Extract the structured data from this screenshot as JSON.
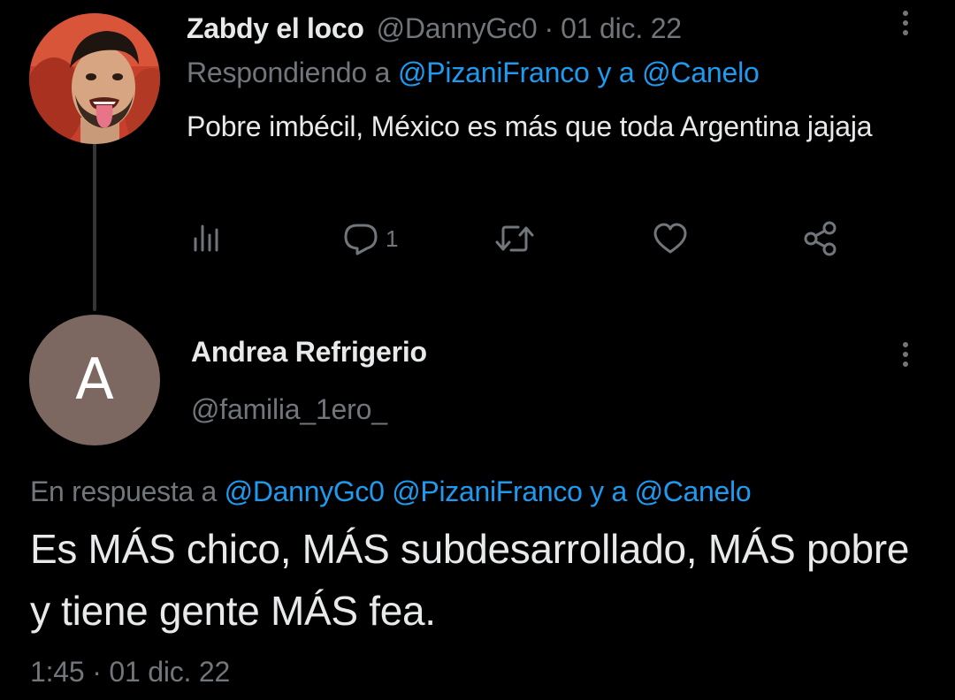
{
  "tweet1": {
    "name": "Zabdy el loco",
    "handle": "@DannyGc0",
    "separator": "·",
    "date": "01 dic. 22",
    "reply_prefix": "Respondiendo a",
    "reply_to_1": "@PizaniFranco",
    "reply_joiner": "y a",
    "reply_to_2": "@Canelo",
    "text": "Pobre imbécil, México es más que toda Argentina jajaja",
    "reply_count": "1",
    "icons": [
      "views-icon",
      "reply-icon",
      "retweet-icon",
      "like-icon",
      "share-icon",
      "more-icon"
    ]
  },
  "tweet2": {
    "name": "Andrea Refrigerio",
    "handle": "@familia_1ero_",
    "avatar_letter": "A",
    "avatar_color": "#7c6860",
    "reply_prefix": "En respuesta a",
    "reply_to_1": "@DannyGc0",
    "reply_to_2": "@PizaniFranco",
    "reply_joiner": "y a",
    "reply_to_3": "@Canelo",
    "text": "Es MÁS chico, MÁS subdesarrollado, MÁS pobre y tiene gente MÁS fea.",
    "time": "1:45",
    "separator": "·",
    "date": "01 dic. 22"
  },
  "colors": {
    "background": "#000000",
    "text_primary": "#e7e9ea",
    "text_secondary": "#71767b",
    "link": "#1d9bf0",
    "thread_line": "#333639"
  }
}
